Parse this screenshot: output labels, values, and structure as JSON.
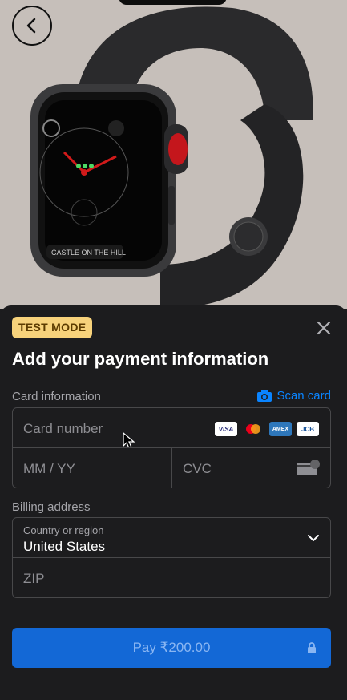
{
  "header": {
    "back_label": ""
  },
  "product_image": {
    "watch_face_text": "CASTLE ON THE HILL"
  },
  "sheet": {
    "badge": "TEST MODE",
    "title": "Add your payment information",
    "card_section": {
      "label": "Card information",
      "scan_label": "Scan card",
      "card_number_placeholder": "Card number",
      "expiry_placeholder": "MM / YY",
      "cvc_placeholder": "CVC",
      "brands": [
        "VISA",
        "mastercard",
        "AMEX",
        "JCB"
      ]
    },
    "billing_section": {
      "label": "Billing address",
      "country_label": "Country or region",
      "country_value": "United States",
      "zip_placeholder": "ZIP"
    },
    "pay_button": {
      "label": "Pay ₹200.00"
    }
  },
  "colors": {
    "accent": "#0a84ff",
    "pay_button": "#1368d6",
    "badge": "#f7d27b",
    "sheet_bg": "#1c1c1e"
  }
}
